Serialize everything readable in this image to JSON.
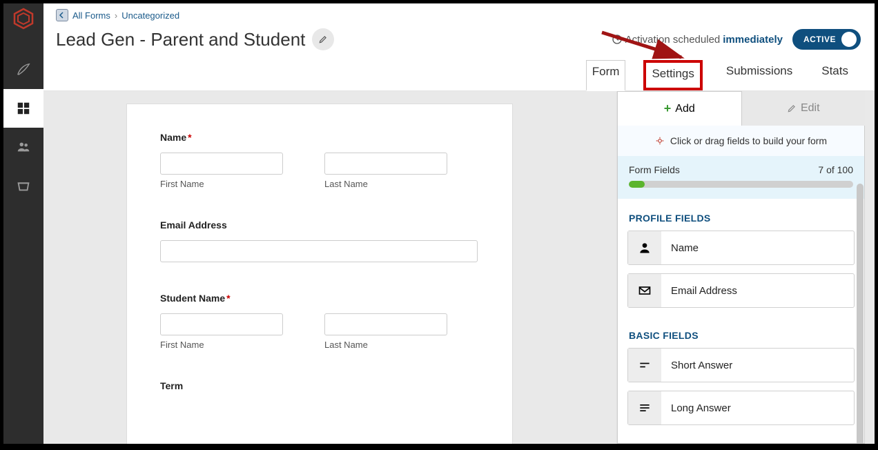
{
  "breadcrumb": {
    "all_forms": "All Forms",
    "category": "Uncategorized"
  },
  "title": "Lead Gen - Parent and Student",
  "activation": {
    "label": "Activation scheduled",
    "immediately": "immediately"
  },
  "active_pill": "ACTIVE",
  "tabs": {
    "form": "Form",
    "settings": "Settings",
    "submissions": "Submissions",
    "stats": "Stats"
  },
  "form": {
    "name": {
      "label": "Name",
      "first": "First Name",
      "last": "Last Name"
    },
    "email": {
      "label": "Email Address"
    },
    "student": {
      "label": "Student Name",
      "first": "First Name",
      "last": "Last Name"
    },
    "term": {
      "label": "Term"
    }
  },
  "rpanel": {
    "add": "Add",
    "edit": "Edit",
    "hint": "Click or drag fields to build your form",
    "count": {
      "label": "Form Fields",
      "value": "7 of 100"
    },
    "profile_title": "PROFILE FIELDS",
    "profile": {
      "name": "Name",
      "email": "Email Address"
    },
    "basic_title": "BASIC FIELDS",
    "basic": {
      "short": "Short Answer",
      "long": "Long Answer"
    }
  }
}
